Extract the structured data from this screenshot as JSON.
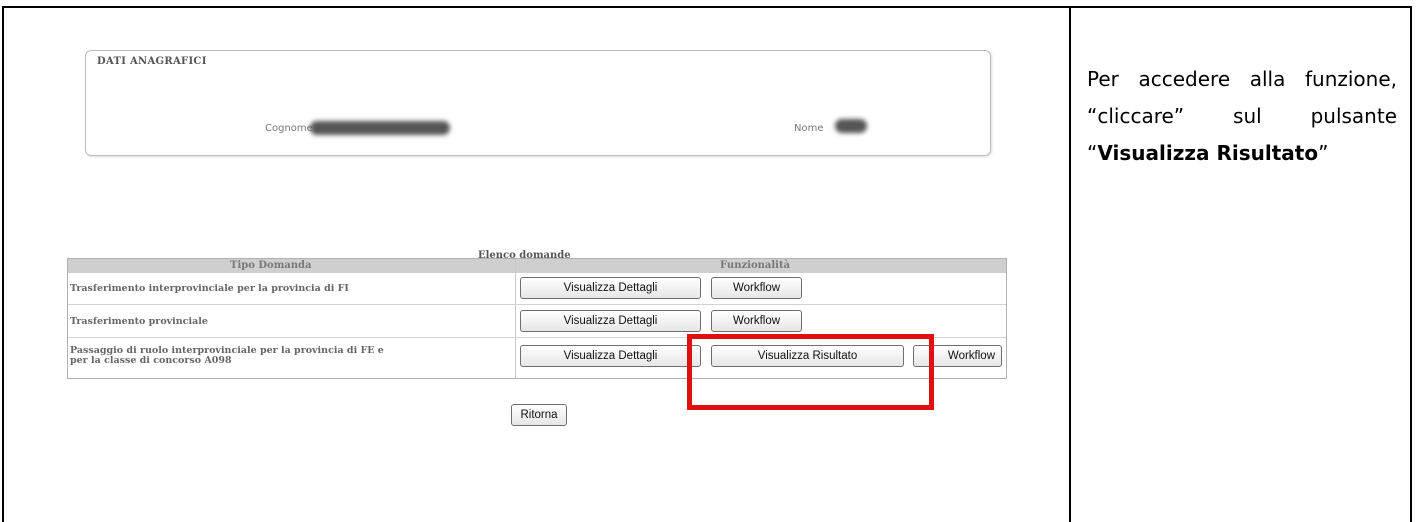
{
  "anagrafica": {
    "legend": "DATI ANAGRAFICI",
    "cognome_label": "Cognome",
    "nome_label": "Nome"
  },
  "elenco": {
    "caption": "Elenco domande",
    "col_tipo": "Tipo Domanda",
    "col_funz": "Funzionalità",
    "rows": [
      {
        "tipo": "Trasferimento interprovinciale per la provincia di FI",
        "btn_dettagli": "Visualizza Dettagli",
        "btn_workflow": "Workflow"
      },
      {
        "tipo": "Trasferimento provinciale",
        "btn_dettagli": "Visualizza Dettagli",
        "btn_workflow": "Workflow"
      },
      {
        "tipo": "Passaggio di ruolo interprovinciale per la provincia di FE e\nper la classe di concorso A098",
        "btn_dettagli": "Visualizza Dettagli",
        "btn_risultato": "Visualizza Risultato",
        "btn_workflow": "Workflow"
      }
    ],
    "btn_ritorna": "Ritorna"
  },
  "instruction": {
    "text_before": "Per accedere alla funzione, “cliccare” sul pulsante “",
    "bold": "Visualizza Risultato",
    "text_after": "”"
  },
  "colors": {
    "highlight": "#e01010",
    "header_bg": "#cfcfcf"
  }
}
